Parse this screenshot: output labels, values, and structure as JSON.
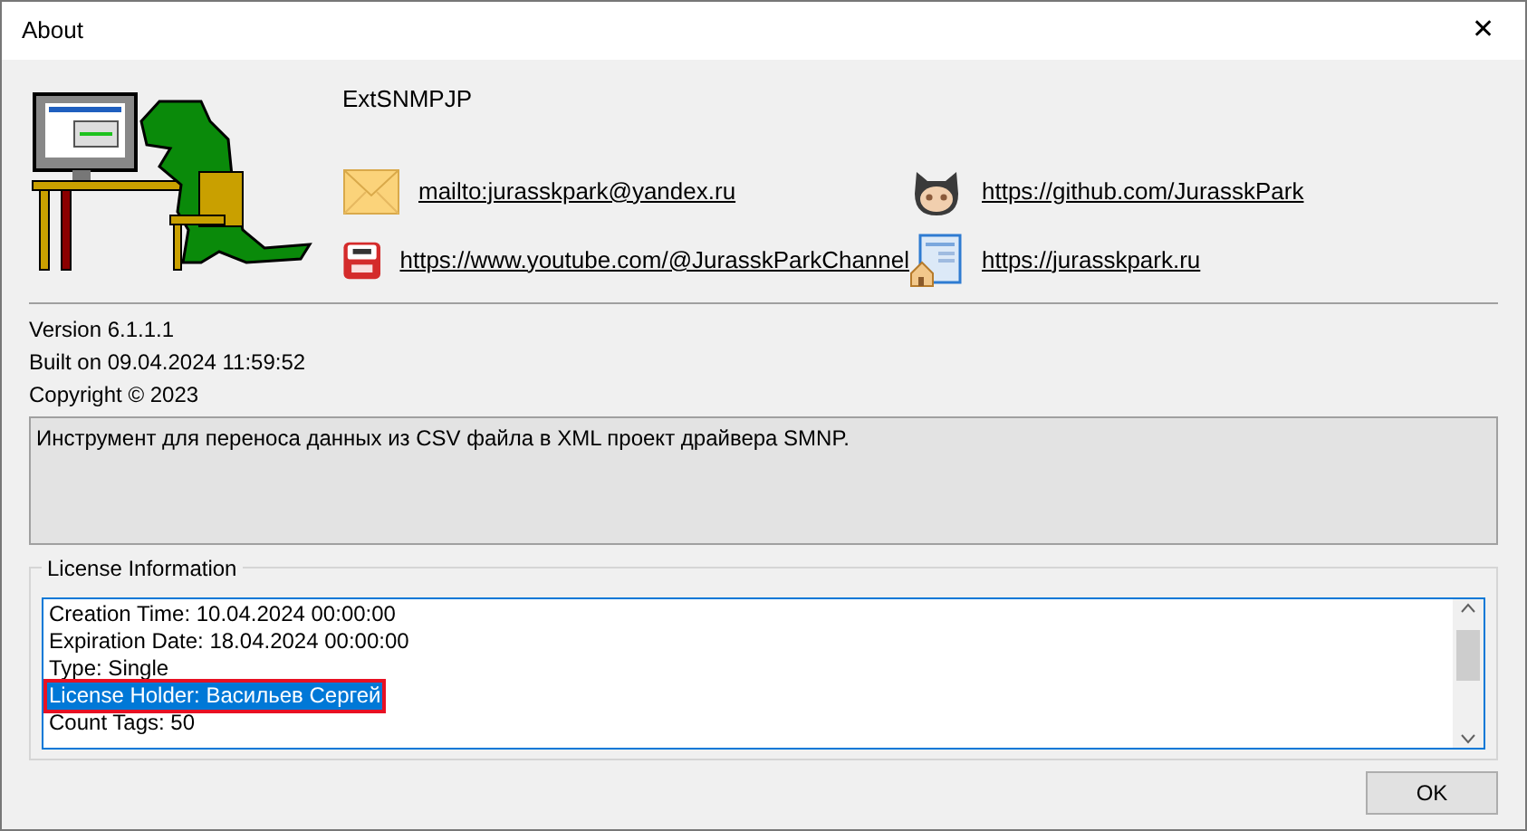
{
  "window": {
    "title": "About",
    "close": "✕"
  },
  "app_name": "ExtSNMPJP",
  "links": [
    {
      "kind": "mail",
      "url": "mailto:jurasskpark@yandex.ru"
    },
    {
      "kind": "github",
      "url": "https://github.com/JurasskPark"
    },
    {
      "kind": "youtube",
      "url": "https://www.youtube.com/@JurasskParkChannel"
    },
    {
      "kind": "site",
      "url": "https://jurasskpark.ru"
    }
  ],
  "info": [
    "Version 6.1.1.1",
    "Built on 09.04.2024 11:59:52",
    "Copyright © 2023"
  ],
  "description": "Инструмент для переноса данных из CSV файла в XML проект драйвера SMNP.",
  "license": {
    "title": "License Information",
    "lines": [
      {
        "text": "Creation Time: 10.04.2024 00:00:00",
        "selected": false,
        "outlined": false
      },
      {
        "text": "Expiration Date: 18.04.2024 00:00:00",
        "selected": false,
        "outlined": false
      },
      {
        "text": "Type: Single",
        "selected": false,
        "outlined": false
      },
      {
        "text": "License Holder: Васильев Сергей",
        "selected": true,
        "outlined": true
      },
      {
        "text": "Count Tags: 50",
        "selected": false,
        "outlined": false
      }
    ]
  },
  "buttons": [
    "OK"
  ]
}
